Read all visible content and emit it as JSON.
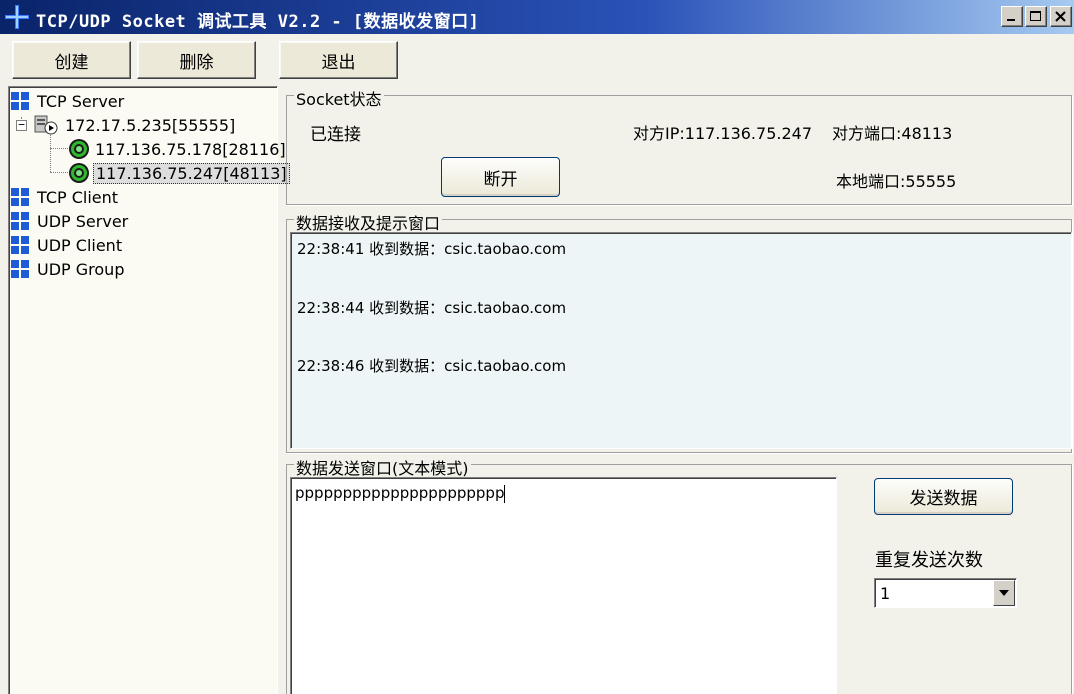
{
  "window": {
    "title": "TCP/UDP Socket 调试工具 V2.2 - [数据收发窗口]"
  },
  "toolbar": {
    "create_label": "创建",
    "delete_label": "删除",
    "exit_label": "退出"
  },
  "tree": {
    "tcp_server": "TCP Server",
    "server_node": "172.17.5.235[55555]",
    "client1": "117.136.75.178[28116]",
    "client2": "117.136.75.247[48113]",
    "tcp_client": "TCP Client",
    "udp_server": "UDP Server",
    "udp_client": "UDP Client",
    "udp_group": "UDP Group"
  },
  "socket_status": {
    "group_title": "Socket状态",
    "status": "已连接",
    "remote_ip": "对方IP:117.136.75.247",
    "remote_port": "对方端口:48113",
    "local_port": "本地端口:55555",
    "disconnect_label": "断开"
  },
  "receive": {
    "group_title": "数据接收及提示窗口",
    "lines": [
      "22:38:41 收到数据：csic.taobao.com",
      "22:38:44 收到数据：csic.taobao.com",
      "22:38:46 收到数据：csic.taobao.com"
    ]
  },
  "send": {
    "group_title": "数据发送窗口(文本模式)",
    "text": "pppppppppppppppppppppp",
    "send_label": "发送数据",
    "repeat_label": "重复发送次数",
    "repeat_value": "1"
  },
  "colors": {
    "title_bar": "#0a246a",
    "receive_bg": "#eef5f7",
    "panel_bg": "#f2f2ea"
  },
  "icons": {
    "app": "network-grid-icon",
    "tree_category": "blue-grid-icon",
    "server_node": "server-play-icon",
    "client_node": "green-target-icon"
  }
}
